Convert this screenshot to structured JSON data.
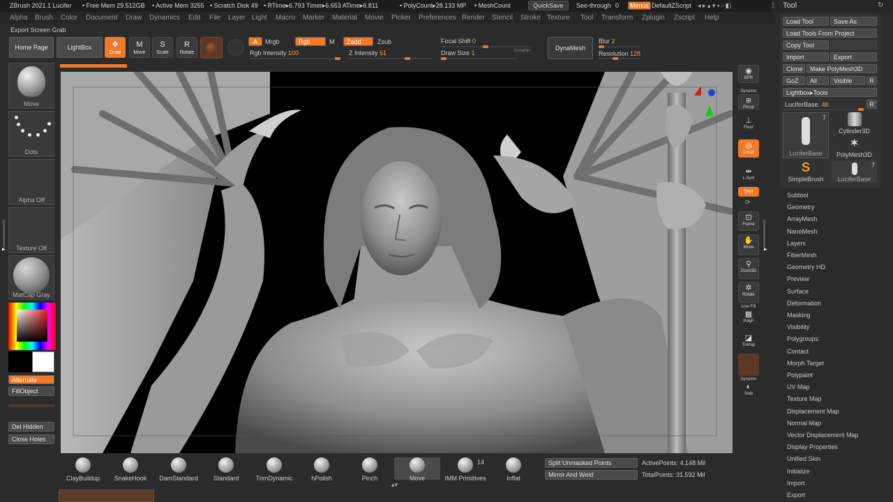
{
  "statusbar": {
    "app": "ZBrush 2021.1 Lucifer",
    "free_mem": "• Free Mem 29.512GB",
    "active_mem": "• Active Mem 3255",
    "scratch": "• Scratch Disk 49",
    "rtime": "• RTime▸6.793 Timer▸6.653 ATime▸6.811",
    "polycount": "• PolyCount▸28.133 MP",
    "meshcount": "• MeshCount",
    "quicksave": "QuickSave",
    "seethrough_label": "See-through",
    "seethrough_value": "0",
    "menus": "Menus",
    "defaultzscript": "DefaultZScript"
  },
  "menubar": [
    "Alpha",
    "Brush",
    "Color",
    "Document",
    "Draw",
    "Dynamics",
    "Edit",
    "File",
    "Layer",
    "Light",
    "Macro",
    "Marker",
    "Material",
    "Movie",
    "Picker",
    "Preferences",
    "Render",
    "Stencil",
    "Stroke",
    "Texture",
    "Tool",
    "Transform",
    "Zplugin",
    "Zscript",
    "Help"
  ],
  "export_grab": "Export Screen Grab",
  "toolbar": {
    "home": "Home Page",
    "lightbox": "LightBox",
    "draw": "Draw",
    "move": "Move",
    "scale": "Scale",
    "rotate": "Rotate",
    "a": "A",
    "mrgb": "Mrgb",
    "rgb": "Rgb",
    "m": "M",
    "zadd": "Zadd",
    "zsub": "Zsub",
    "rgb_intensity_label": "Rgb Intensity",
    "rgb_intensity": "100",
    "z_intensity_label": "Z Intensity",
    "z_intensity": "51",
    "focal_shift_label": "Focal Shift",
    "focal_shift": "0",
    "draw_size_label": "Draw Size",
    "draw_size": "1",
    "dynamic": "Dynamic",
    "dynamesh": "DynaMesh",
    "blur_label": "Blur",
    "blur": "2",
    "resolution_label": "Resolution",
    "resolution": "128"
  },
  "left": {
    "move": "Move",
    "dots": "Dots",
    "alpha": "Alpha Off",
    "texture": "Texture Off",
    "matcap": "MatCap Gray",
    "alternate": "Alternate",
    "fillobject": "FillObject",
    "del_hidden": "Del Hidden",
    "close_holes": "Close Holes"
  },
  "right_shelf": {
    "bpr": "BPR",
    "dynamic": "Dynamic",
    "persp": "Persp",
    "floor": "Floor",
    "local": "Local",
    "lsym": "L.Sym",
    "xyz": "Qxyz",
    "frame": "Frame",
    "move": "Move",
    "zoom3d": "Zoom3D",
    "rotate": "Rotate",
    "linefill": "Line Fill",
    "polyf": "PolyF",
    "transp": "Transp",
    "dynamic2": "Dynamic",
    "solo": "Solo"
  },
  "toolpanel": {
    "title": "Tool",
    "load_tool": "Load Tool",
    "save_as": "Save As",
    "load_from_project": "Load Tools From Project",
    "copy_tool": "Copy Tool",
    "import": "Import",
    "export": "Export",
    "clone": "Clone",
    "make_polymesh": "Make PolyMesh3D",
    "goz": "GoZ",
    "all": "All",
    "visible": "Visible",
    "r": "R",
    "lightbox_tools": "Lightbox▸Tools",
    "current_label": "LuciferBase.",
    "current_value": "48",
    "thumbs": [
      {
        "name": "LuciferBase",
        "count": "7"
      },
      {
        "name": "Cylinder3D",
        "count": ""
      },
      {
        "name": "PolyMesh3D",
        "count": ""
      },
      {
        "name": "SimpleBrush",
        "count": ""
      },
      {
        "name": "LuciferBase",
        "count": "7"
      }
    ],
    "subpalettes": [
      "Subtool",
      "Geometry",
      "ArrayMesh",
      "NanoMesh",
      "Layers",
      "FiberMesh",
      "Geometry HD",
      "Preview",
      "Surface",
      "Deformation",
      "Masking",
      "Visibility",
      "Polygroups",
      "Contact",
      "Morph Target",
      "Polypaint",
      "UV Map",
      "Texture Map",
      "Displacement Map",
      "Normal Map",
      "Vector Displacement Map",
      "Display Properties",
      "Unified Skin",
      "Initialize",
      "Import",
      "Export"
    ]
  },
  "brushes": [
    {
      "name": "ClayBuildup"
    },
    {
      "name": "SnakeHook"
    },
    {
      "name": "DamStandard"
    },
    {
      "name": "Standard"
    },
    {
      "name": "TrimDynamic"
    },
    {
      "name": "hPolish"
    },
    {
      "name": "Pinch"
    },
    {
      "name": "Move"
    },
    {
      "name": "IMM Primitives",
      "count": "14"
    },
    {
      "name": "Inflat"
    }
  ],
  "bottom": {
    "split_unmasked": "Split Unmasked Points",
    "mirror_weld": "Mirror And Weld",
    "active_points_label": "ActivePoints:",
    "active_points": "4.148 Mil",
    "total_points_label": "TotalPoints:",
    "total_points": "31.592 Mil"
  },
  "colors": {
    "accent": "#f0792a",
    "bg": "#2b2b2b"
  }
}
